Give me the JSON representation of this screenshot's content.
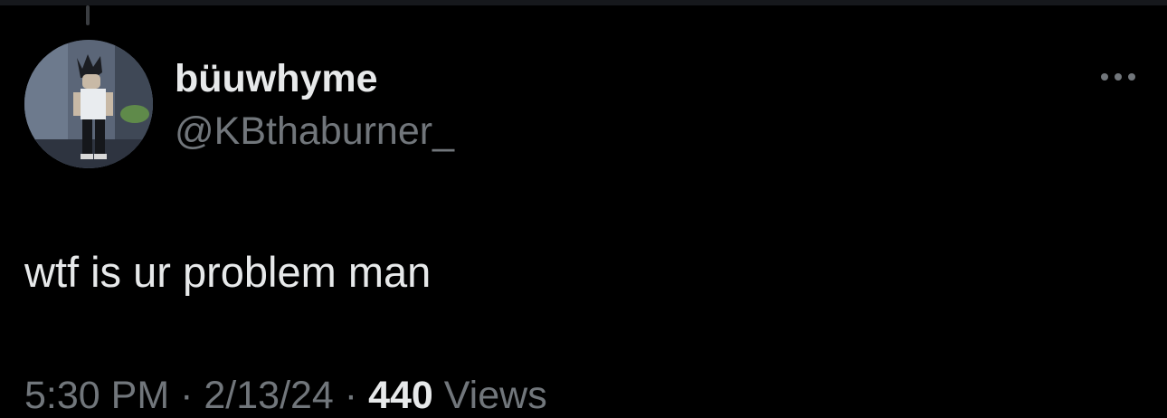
{
  "author": {
    "display_name": "büuwhyme",
    "handle": "@KBthaburner_"
  },
  "tweet": {
    "text": "wtf is ur problem man"
  },
  "meta": {
    "time": "5:30 PM",
    "separator": "·",
    "date": "2/13/24",
    "views_count": "440",
    "views_label": "Views"
  },
  "icons": {
    "more": "more-horizontal-icon"
  },
  "colors": {
    "background": "#000000",
    "primary_text": "#e7e9ea",
    "secondary_text": "#71767b"
  }
}
